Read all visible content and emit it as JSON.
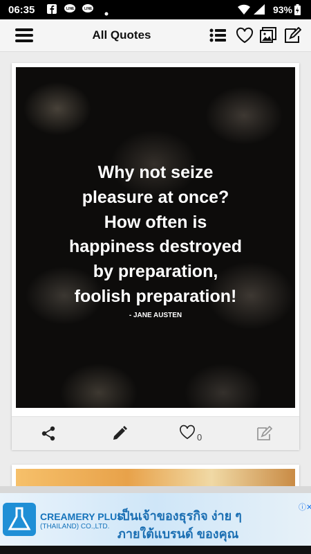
{
  "status_bar": {
    "time": "06:35",
    "battery": "93%",
    "notification_icons": [
      "facebook-icon",
      "line-icon",
      "line-icon",
      "dot-icon"
    ],
    "system_icons": [
      "wifi-icon",
      "signal-icon",
      "battery-icon"
    ]
  },
  "app_bar": {
    "title": "All Quotes",
    "left_icon": "menu-icon",
    "right_icons": [
      "list-icon",
      "heart-icon",
      "gallery-icon",
      "edit-icon"
    ]
  },
  "quote_card": {
    "lines": [
      "Why not seize",
      "pleasure at once?",
      "How often is",
      "happiness destroyed",
      "by preparation,",
      "foolish preparation!"
    ],
    "author": "- JANE AUSTEN",
    "like_count": "0",
    "action_icons": [
      "share-icon",
      "pencil-icon",
      "heart-outline-icon",
      "edit-icon"
    ]
  },
  "ad": {
    "brand": "CREAMERY PLUS",
    "brand_sub": "(THAILAND) CO.,LTD.",
    "headline_1": "เป็นเจ้าของธุรกิจ ง่าย ๆ",
    "headline_2": "ภายใต้แบรนด์ ของคุณ",
    "badge": "ⓘ✕"
  },
  "colors": {
    "accent": "#1573bb",
    "card_bg": "#ffffff",
    "page_bg": "#ececec",
    "quote_bg": "#0d0c0b"
  }
}
